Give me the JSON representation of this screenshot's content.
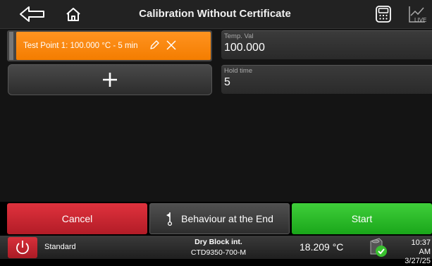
{
  "header": {
    "title": "Calibration Without Certificate",
    "back_icon": "back-arrow-icon",
    "home_icon": "home-icon",
    "calculator_icon": "calculator-icon",
    "live_icon": "live-chart-icon",
    "live_label": "LIVE"
  },
  "test_points": [
    {
      "label": "Test Point 1: 100.000 °C - 5 min",
      "edit_icon": "pencil-icon",
      "delete_icon": "close-icon"
    }
  ],
  "add_button": {
    "icon": "plus-icon"
  },
  "fields": {
    "temp_val": {
      "label": "Temp. Val",
      "value": "100.000"
    },
    "hold_time": {
      "label": "Hold time",
      "value": "5"
    }
  },
  "actions": {
    "cancel": "Cancel",
    "behaviour": "Behaviour at the End",
    "behaviour_icon": "flag-icon",
    "start": "Start"
  },
  "status": {
    "mode": "Standard",
    "device_name": "Dry Block int.",
    "device_model": "CTD9350-700-M",
    "temperature": "18.209 °C",
    "time": "10:37 AM",
    "date": "3/27/25"
  },
  "colors": {
    "test_point": "#f47d00",
    "cancel": "#c4222e",
    "start": "#2cbb2a"
  }
}
